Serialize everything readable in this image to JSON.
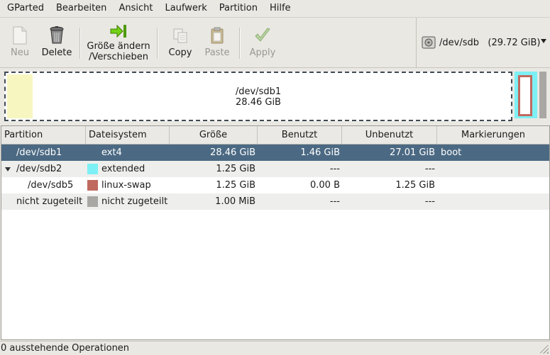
{
  "menubar": {
    "items": [
      {
        "label": "GParted"
      },
      {
        "label": "Bearbeiten"
      },
      {
        "label": "Ansicht"
      },
      {
        "label": "Laufwerk"
      },
      {
        "label": "Partition"
      },
      {
        "label": "Hilfe"
      }
    ]
  },
  "toolbar": {
    "new_label": "Neu",
    "delete_label": "Delete",
    "resize_label_1": "Größe ändern",
    "resize_label_2": "/Verschieben",
    "copy_label": "Copy",
    "paste_label": "Paste",
    "apply_label": "Apply",
    "device_label": "/dev/sdb   (29.72 GiB)",
    "disabled_color": "#9a9893"
  },
  "graphic": {
    "selected_name": "/dev/sdb1",
    "selected_size": "28.46 GiB"
  },
  "table": {
    "headers": [
      "Partition",
      "Dateisystem",
      "Größe",
      "Benutzt",
      "Unbenutzt",
      "Markierungen"
    ],
    "rows": [
      {
        "partition": "/dev/sdb1",
        "filesystem": "ext4",
        "size": "28.46 GiB",
        "used": "1.46 GiB",
        "unused": "27.01 GiB",
        "flags": "boot",
        "swatch": "#f7f6c1",
        "selected": true
      },
      {
        "partition": "/dev/sdb2",
        "filesystem": "extended",
        "size": "1.25 GiB",
        "used": "---",
        "unused": "---",
        "flags": "",
        "swatch": "#7df0f5",
        "expanded": true
      },
      {
        "partition": "/dev/sdb5",
        "filesystem": "linux-swap",
        "size": "1.25 GiB",
        "used": "0.00 B",
        "unused": "1.25 GiB",
        "flags": "",
        "swatch": "#c06a5f"
      },
      {
        "partition": "nicht zugeteilt",
        "filesystem": "nicht zugeteilt",
        "size": "1.00 MiB",
        "used": "---",
        "unused": "---",
        "flags": "",
        "swatch": "#a9a7a3"
      }
    ]
  },
  "status": {
    "text": "0 ausstehende Operationen"
  },
  "colors": {
    "selection": "#4b6983",
    "ext4": "#f7f6c1",
    "extended": "#7df0f5",
    "linux_swap": "#c06a5f",
    "unallocated": "#a9a7a3"
  }
}
